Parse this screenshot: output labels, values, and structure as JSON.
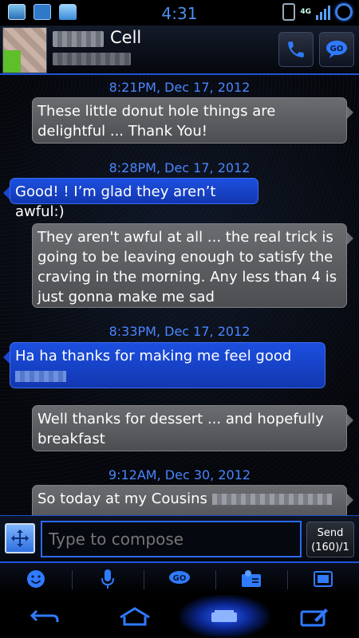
{
  "status_bar": {
    "time": "4:31",
    "network_label": "4G"
  },
  "header": {
    "contact_label": "Cell"
  },
  "conversation": {
    "items": [
      {
        "kind": "timestamp",
        "text": "8:21PM, Dec 17, 2012"
      },
      {
        "kind": "incoming",
        "text": "These little donut hole things are delightful ... Thank You!"
      },
      {
        "kind": "timestamp",
        "text": "8:28PM, Dec 17, 2012"
      },
      {
        "kind": "outgoing",
        "text": "Good! ! I’m glad they aren’t awful:)"
      },
      {
        "kind": "incoming",
        "text": "They aren't awful at all ... the real trick is going to be leaving enough to satisfy the craving in the morning. Any less than 4 is just gonna make me sad"
      },
      {
        "kind": "timestamp",
        "text": "8:33PM, Dec 17, 2012"
      },
      {
        "kind": "outgoing",
        "text": "Ha ha thanks for making me feel good"
      },
      {
        "kind": "incoming",
        "text": "Well thanks for dessert ... and hopefully breakfast"
      },
      {
        "kind": "timestamp",
        "text": "9:12AM, Dec 30, 2012"
      },
      {
        "kind": "incoming",
        "text": "So today at my Cousins"
      }
    ]
  },
  "compose": {
    "placeholder": "Type to compose",
    "send_label": "Send",
    "char_count": "(160)/1"
  },
  "colors": {
    "accent": "#2b6af2",
    "timestamp": "#4a86ff",
    "incoming_bubble": "#5b5d61",
    "outgoing_bubble": "#1a46d0"
  },
  "icons": {
    "toolbar": [
      "smiley-icon",
      "microphone-icon",
      "go-sms-icon",
      "contact-card-icon",
      "template-icon"
    ],
    "nav": [
      "back-icon",
      "home-icon",
      "recent-apps-icon",
      "compose-icon"
    ]
  }
}
